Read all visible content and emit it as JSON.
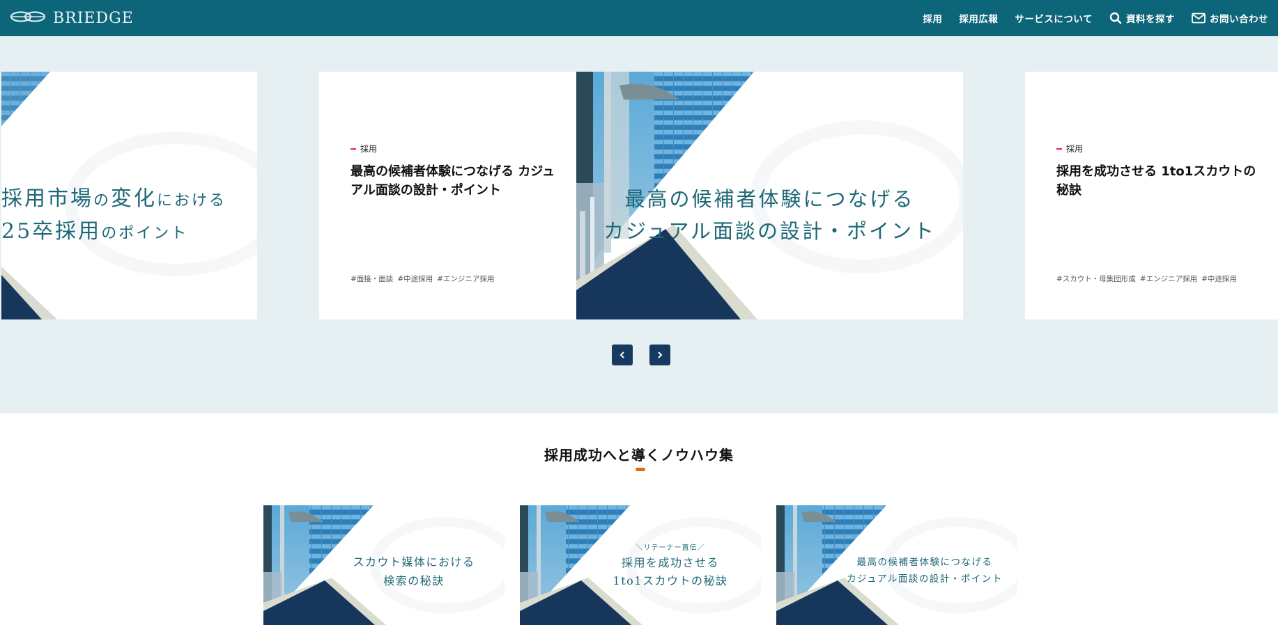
{
  "header": {
    "logo_text": "BRIEDGE",
    "logo_icon": "knot-logo-icon",
    "nav": [
      {
        "label": "採用"
      },
      {
        "label": "採用広報"
      },
      {
        "label": "サービスについて"
      },
      {
        "label": "資料を探す",
        "icon": "search-icon"
      },
      {
        "label": "お問い合わせ",
        "icon": "mail-icon"
      }
    ],
    "bg_color": "#0c6578"
  },
  "slider": {
    "bg_color": "#e6eff2",
    "left_banner": {
      "line1_big": "採用市場",
      "line1_small": "の",
      "line1_big2": "変化",
      "line1_small2": "における",
      "line2_big": "25卒採用",
      "line2_small": "のポイント"
    },
    "center_card": {
      "category": "採用",
      "title": "最高の候補者体験につなげる カジュアル面談の設計・ポイント",
      "tags": [
        "#面接・面談",
        "#中途採用",
        "#エンジニア採用"
      ],
      "banner_line1": "最高の候補者体験につなげる",
      "banner_line2": "カジュアル面談の設計・ポイント"
    },
    "right_card": {
      "category": "採用",
      "title": "採用を成功させる 1to1スカウトの秘訣",
      "tags": [
        "#スカウト・母集団形成",
        "#エンジニア採用",
        "#中途採用"
      ]
    },
    "prev_icon": "chevron-left-icon",
    "next_icon": "chevron-right-icon"
  },
  "knowhow": {
    "title": "採用成功へと導くノウハウ集",
    "accent_color": "#e06a1b",
    "items": [
      {
        "line1": "スカウト媒体における",
        "line2": "検索の秘訣",
        "pre": ""
      },
      {
        "pre": "＼リテーナー直伝／",
        "line1": "採用を成功させる",
        "line2": "1to1スカウトの秘訣"
      },
      {
        "pre": "",
        "line1": "最高の候補者体験につなげる",
        "line2": "カジュアル面談の設計・ポイント"
      }
    ]
  }
}
